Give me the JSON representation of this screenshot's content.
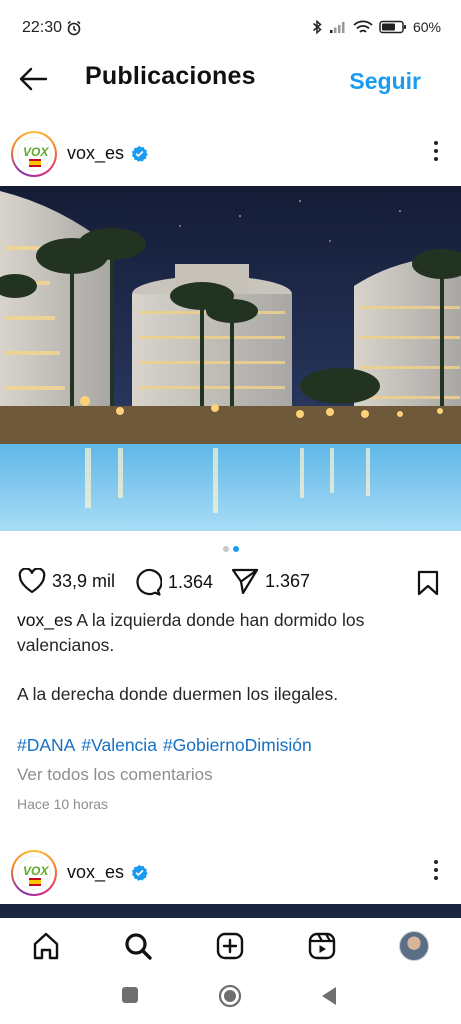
{
  "status_bar": {
    "time": "22:30",
    "battery": "60%",
    "icons": [
      "alarm-icon",
      "bluetooth-icon",
      "signal-icon",
      "wifi-icon",
      "battery-icon"
    ]
  },
  "header": {
    "title": "Publicaciones",
    "follow_label": "Seguir",
    "back_icon": "arrow-left-icon"
  },
  "posts": [
    {
      "username": "vox_es",
      "avatar_text": "VOX",
      "verified": true,
      "carousel": {
        "count": 2,
        "active": 2
      },
      "likes": "33,9 mil",
      "comments": "1.364",
      "shares": "1.367",
      "caption_user": "vox_es",
      "caption_text": " A la izquierda donde han dormido los valencianos.",
      "caption_line2": "A la derecha donde duermen los ilegales.",
      "hashtags": [
        "#DANA",
        "#Valencia",
        "#GobiernoDimisión"
      ],
      "view_comments": "Ver todos los comentarios",
      "time_ago": "Hace 10 horas"
    },
    {
      "username": "vox_es",
      "avatar_text": "VOX",
      "verified": true
    }
  ],
  "bottom_nav": [
    "home-icon",
    "search-icon",
    "create-icon",
    "reels-icon",
    "profile-avatar"
  ],
  "colors": {
    "accent": "#1a9bf0",
    "hashtag": "#1670c4",
    "muted": "#8e8e8e",
    "verified": "#1a9bf0",
    "vox_green": "#5ea829"
  }
}
